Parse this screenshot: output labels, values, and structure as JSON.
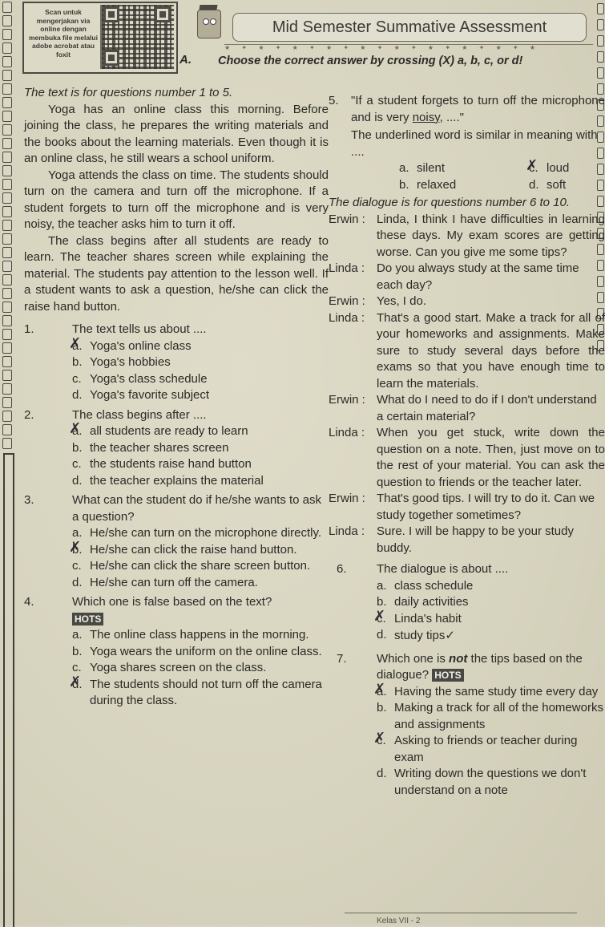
{
  "header": {
    "qr_caption": "Scan untuk mengerjakan via online dengan membuka file melalui adobe acrobat atau foxit",
    "title": "Mid Semester Summative Assessment",
    "section_letter": "A.",
    "instruction": "Choose the correct answer by crossing (X) a, b, c, or d!"
  },
  "reading": {
    "intro": "The text is for questions number 1 to 5.",
    "paragraphs": [
      "Yoga has an online class this morning. Before joining the class, he prepares the writing materials and the books about the learning materials. Even though it is an online class, he still wears a school uniform.",
      "Yoga attends the class on time. The students should turn on the camera and turn off the microphone. If a student forgets to turn off the microphone and is very noisy, the teacher asks him to turn it off.",
      "The class begins after all students are ready to learn. The teacher shares screen while explaining the material. The students pay attention to the lesson well. If a student wants to ask a question, he/she can click the raise hand button."
    ]
  },
  "questions": [
    {
      "number": "1.",
      "text": "The text tells us about ....",
      "options": [
        {
          "letter": "a.",
          "text": "Yoga's online class",
          "crossed": true
        },
        {
          "letter": "b.",
          "text": "Yoga's hobbies",
          "crossed": false
        },
        {
          "letter": "c.",
          "text": "Yoga's class schedule",
          "crossed": false
        },
        {
          "letter": "d.",
          "text": "Yoga's favorite subject",
          "crossed": false
        }
      ]
    },
    {
      "number": "2.",
      "text": "The class begins after ....",
      "options": [
        {
          "letter": "a.",
          "text": "all students are ready to learn",
          "crossed": true
        },
        {
          "letter": "b.",
          "text": "the teacher shares screen",
          "crossed": false
        },
        {
          "letter": "c.",
          "text": "the students raise hand button",
          "crossed": false
        },
        {
          "letter": "d.",
          "text": "the teacher explains the material",
          "crossed": false
        }
      ]
    },
    {
      "number": "3.",
      "text": "What can the student do if he/she wants to ask a question?",
      "options": [
        {
          "letter": "a.",
          "text": "He/she can turn on the microphone directly.",
          "crossed": false
        },
        {
          "letter": "b.",
          "text": "He/she can click the raise hand button.",
          "crossed": true
        },
        {
          "letter": "c.",
          "text": "He/she can click the share screen button.",
          "crossed": false
        },
        {
          "letter": "d.",
          "text": "He/she can turn off the camera.",
          "crossed": false
        }
      ]
    },
    {
      "number": "4.",
      "text": "Which one is false based on the text?",
      "badge": "HOTS",
      "options": [
        {
          "letter": "a.",
          "text": "The online class happens in the morning.",
          "crossed": false
        },
        {
          "letter": "b.",
          "text": "Yoga wears the uniform on the online class.",
          "crossed": false
        },
        {
          "letter": "c.",
          "text": "Yoga shares screen on the class.",
          "crossed": false
        },
        {
          "letter": "d.",
          "text": "The students should not turn off the camera during the class.",
          "crossed": true
        }
      ]
    },
    {
      "number": "5.",
      "quote_before": "\"If a student forgets to turn off the microphone and is very ",
      "quote_underlined": "noisy",
      "quote_after": ", ....\"",
      "text": "The underlined word is similar in meaning with ....",
      "options": [
        {
          "letter": "a.",
          "text": "silent",
          "crossed": false
        },
        {
          "letter": "c.",
          "text": "loud",
          "crossed": true
        },
        {
          "letter": "b.",
          "text": "relaxed",
          "crossed": false
        },
        {
          "letter": "d.",
          "text": "soft",
          "crossed": false
        }
      ]
    }
  ],
  "dialogue": {
    "intro": "The dialogue is for questions number 6 to 10.",
    "lines": [
      {
        "speaker": "Erwin :",
        "text": "Linda, I think I have difficulties in learning these days. My exam scores are getting worse. Can you give me some tips?"
      },
      {
        "speaker": "Linda :",
        "text": "Do you always study at the same time each day?"
      },
      {
        "speaker": "Erwin :",
        "text": "Yes, I do."
      },
      {
        "speaker": "Linda :",
        "text": "That's a good start. Make a track for all of your homeworks and assignments. Make sure to study several days before the exams so that you have enough time to learn the materials."
      },
      {
        "speaker": "Erwin :",
        "text": "What do I need to do if I don't understand a certain material?"
      },
      {
        "speaker": "Linda :",
        "text": "When you get stuck, write down the question on a note. Then, just move on to the rest of your material. You can ask the question to friends or the teacher later."
      },
      {
        "speaker": "Erwin :",
        "text": "That's good tips. I will try to do it. Can we study together sometimes?"
      },
      {
        "speaker": "Linda :",
        "text": "Sure. I will be happy to be your study buddy."
      }
    ]
  },
  "dialogue_questions": [
    {
      "number": "6.",
      "text": "The dialogue is about ....",
      "options": [
        {
          "letter": "a.",
          "text": "class schedule",
          "crossed": false
        },
        {
          "letter": "b.",
          "text": "daily activities",
          "crossed": false
        },
        {
          "letter": "c.",
          "text": "Linda's habit",
          "crossed": true
        },
        {
          "letter": "d.",
          "text": "study tips",
          "crossed": false,
          "check": "✓"
        }
      ]
    },
    {
      "number": "7.",
      "text_before": "Which one is ",
      "text_emph": "not",
      "text_after": " the tips based on the dialogue?",
      "badge": "HOTS",
      "options": [
        {
          "letter": "a.",
          "text": "Having the same study time every day",
          "crossed": true
        },
        {
          "letter": "b.",
          "text": "Making a track for all of the homeworks and assignments",
          "crossed": false
        },
        {
          "letter": "c.",
          "text": "Asking to friends or teacher during exam",
          "crossed": true
        },
        {
          "letter": "d.",
          "text": "Writing down the questions we don't understand on a note",
          "crossed": false
        }
      ]
    }
  ],
  "footer": {
    "text": "Kelas VII - 2"
  }
}
